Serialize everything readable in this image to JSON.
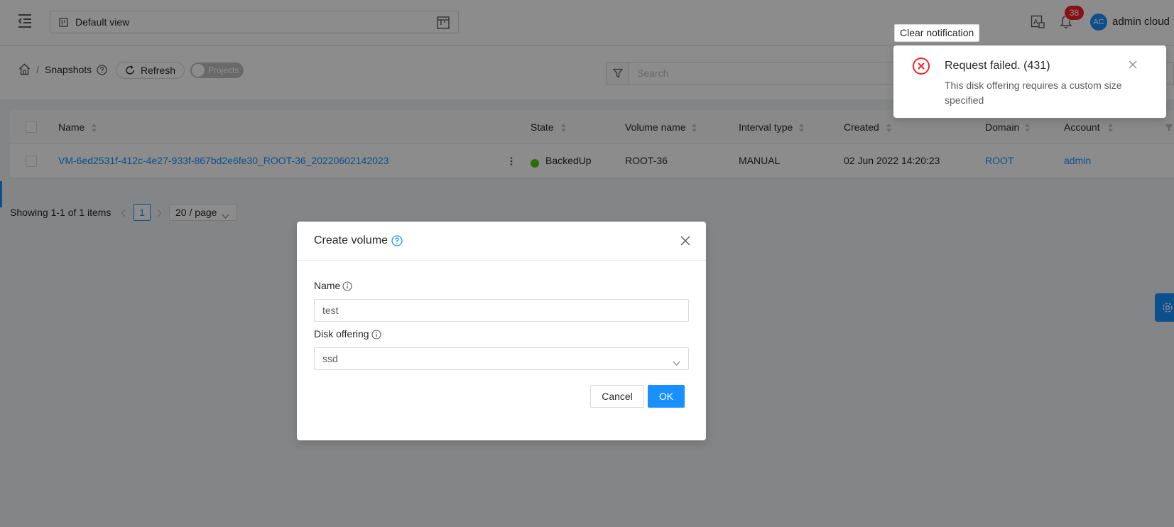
{
  "header": {
    "view_label": "Default view",
    "notification_count": "38",
    "user_initials": "AC",
    "user_name": "admin cloud"
  },
  "breadcrumb": {
    "title": "Snapshots",
    "separator": "/",
    "refresh_label": "Refresh",
    "projects_toggle_label": "Projects",
    "projects_toggle_on": false
  },
  "search": {
    "placeholder": "Search"
  },
  "table": {
    "columns": [
      "Name",
      "State",
      "Volume name",
      "Interval type",
      "Created",
      "Domain",
      "Account"
    ],
    "rows": [
      {
        "name": "VM-6ed2531f-412c-4e27-933f-867bd2e6fe30_ROOT-36_20220602142023",
        "state": "BackedUp",
        "volume_name": "ROOT-36",
        "interval_type": "MANUAL",
        "created": "02 Jun 2022 14:20:23",
        "domain": "ROOT",
        "account": "admin"
      }
    ]
  },
  "pagination": {
    "total_text": "Showing 1-1 of 1 items",
    "current_page": "1",
    "page_size": "20 / page"
  },
  "modal": {
    "title": "Create volume",
    "name_label": "Name",
    "name_value": "test",
    "disk_offering_label": "Disk offering",
    "disk_offering_value": "ssd",
    "cancel_label": "Cancel",
    "ok_label": "OK"
  },
  "notification": {
    "clear_label": "Clear notification",
    "title": "Request failed. (431)",
    "description": "This disk offering requires a custom size specified"
  },
  "colors": {
    "primary": "#1890ff",
    "error": "#f5222d",
    "success": "#52c41a"
  },
  "icons": [
    "menu-fold-icon",
    "view-icon",
    "layout-icon",
    "translate-icon",
    "bell-icon",
    "home-icon",
    "question-icon",
    "reload-icon",
    "filter-icon",
    "sort-icon",
    "more-icon",
    "close-icon",
    "info-icon",
    "chevron-down-icon",
    "close-circle-icon",
    "settings-icon",
    "left-icon",
    "right-icon"
  ]
}
